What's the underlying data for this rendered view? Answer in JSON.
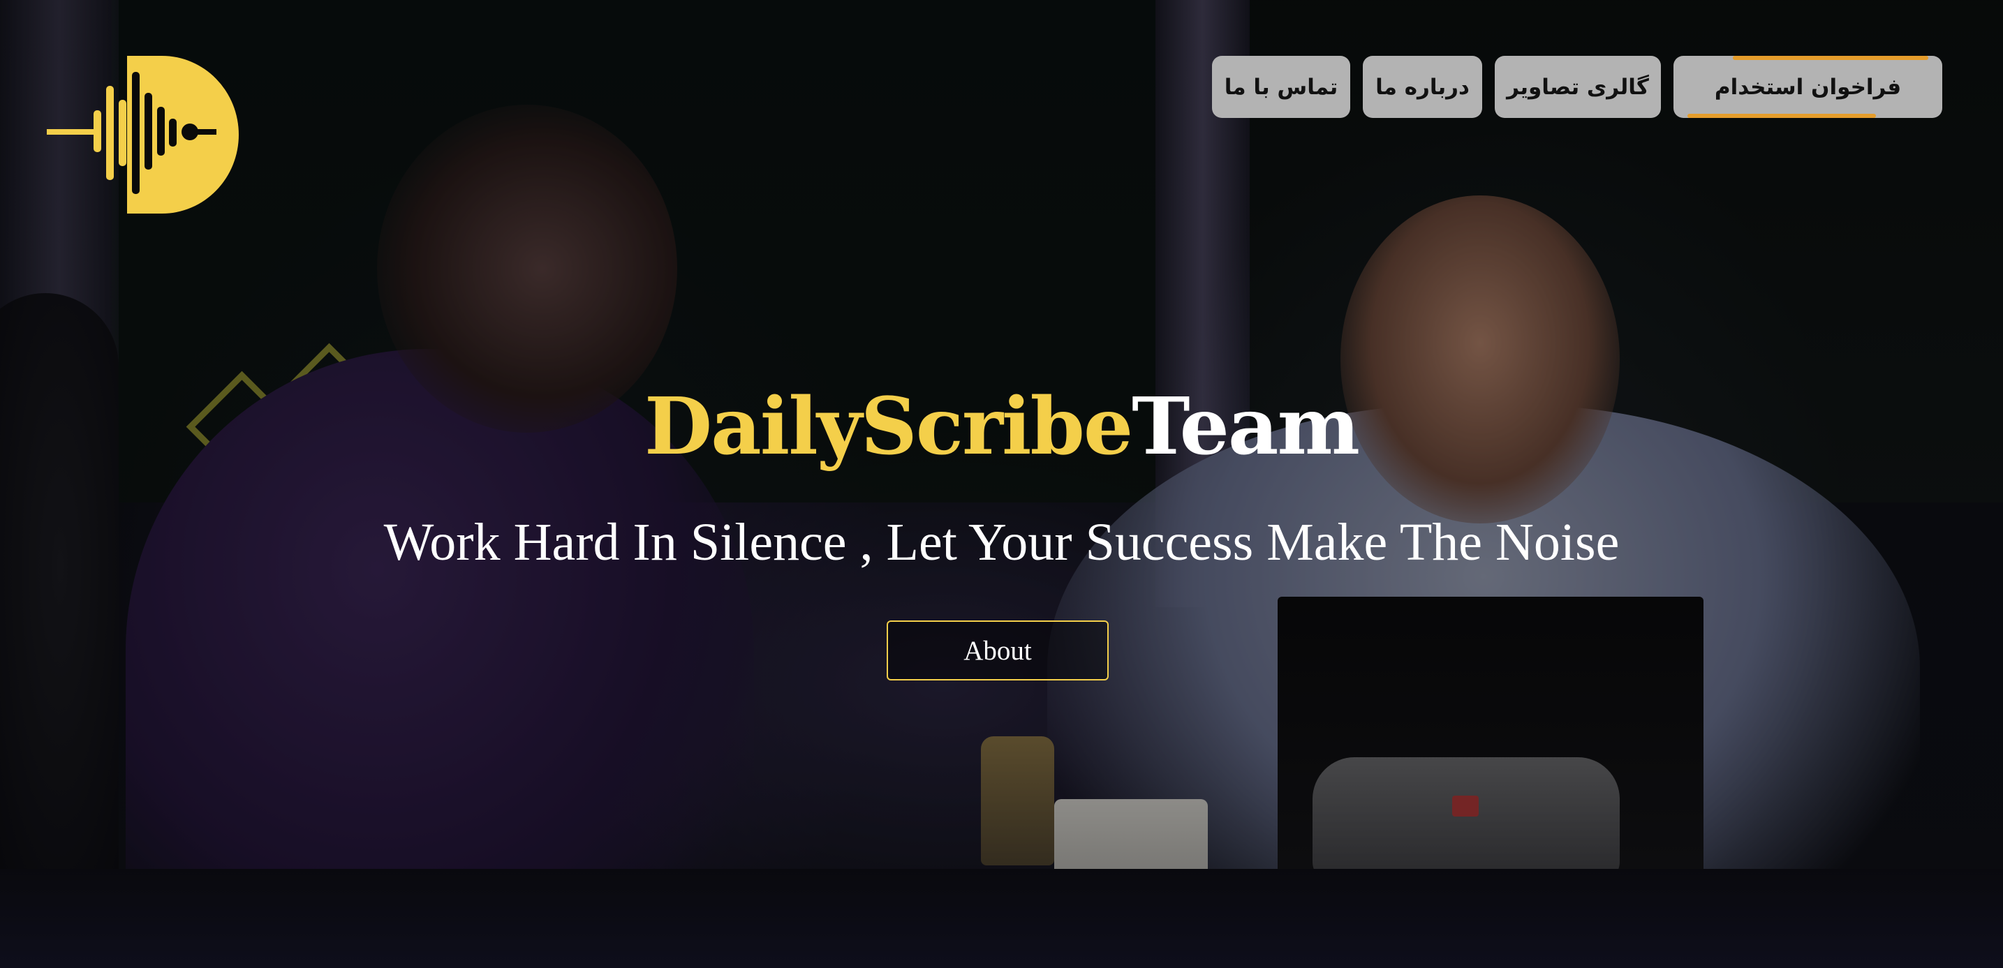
{
  "brand": {
    "logo_icon": "waveform-d-logo",
    "accent_color": "#f4cf4a"
  },
  "nav": {
    "items": [
      {
        "label": "فراخوان استخدام",
        "icon": "none"
      },
      {
        "label": "گالری تصاویر"
      },
      {
        "label": "درباره ما"
      },
      {
        "label": "تماس با ما"
      }
    ],
    "button_bg": "#b3b3b3",
    "active_accent": "#e59d2c"
  },
  "hero": {
    "title_brand": "DailyScribe",
    "title_team": "Team",
    "tagline": "Work Hard In Silence , Let Your Success Make The Noise",
    "cta_label": "About"
  },
  "background": {
    "description_icon": "office-photo-background"
  }
}
